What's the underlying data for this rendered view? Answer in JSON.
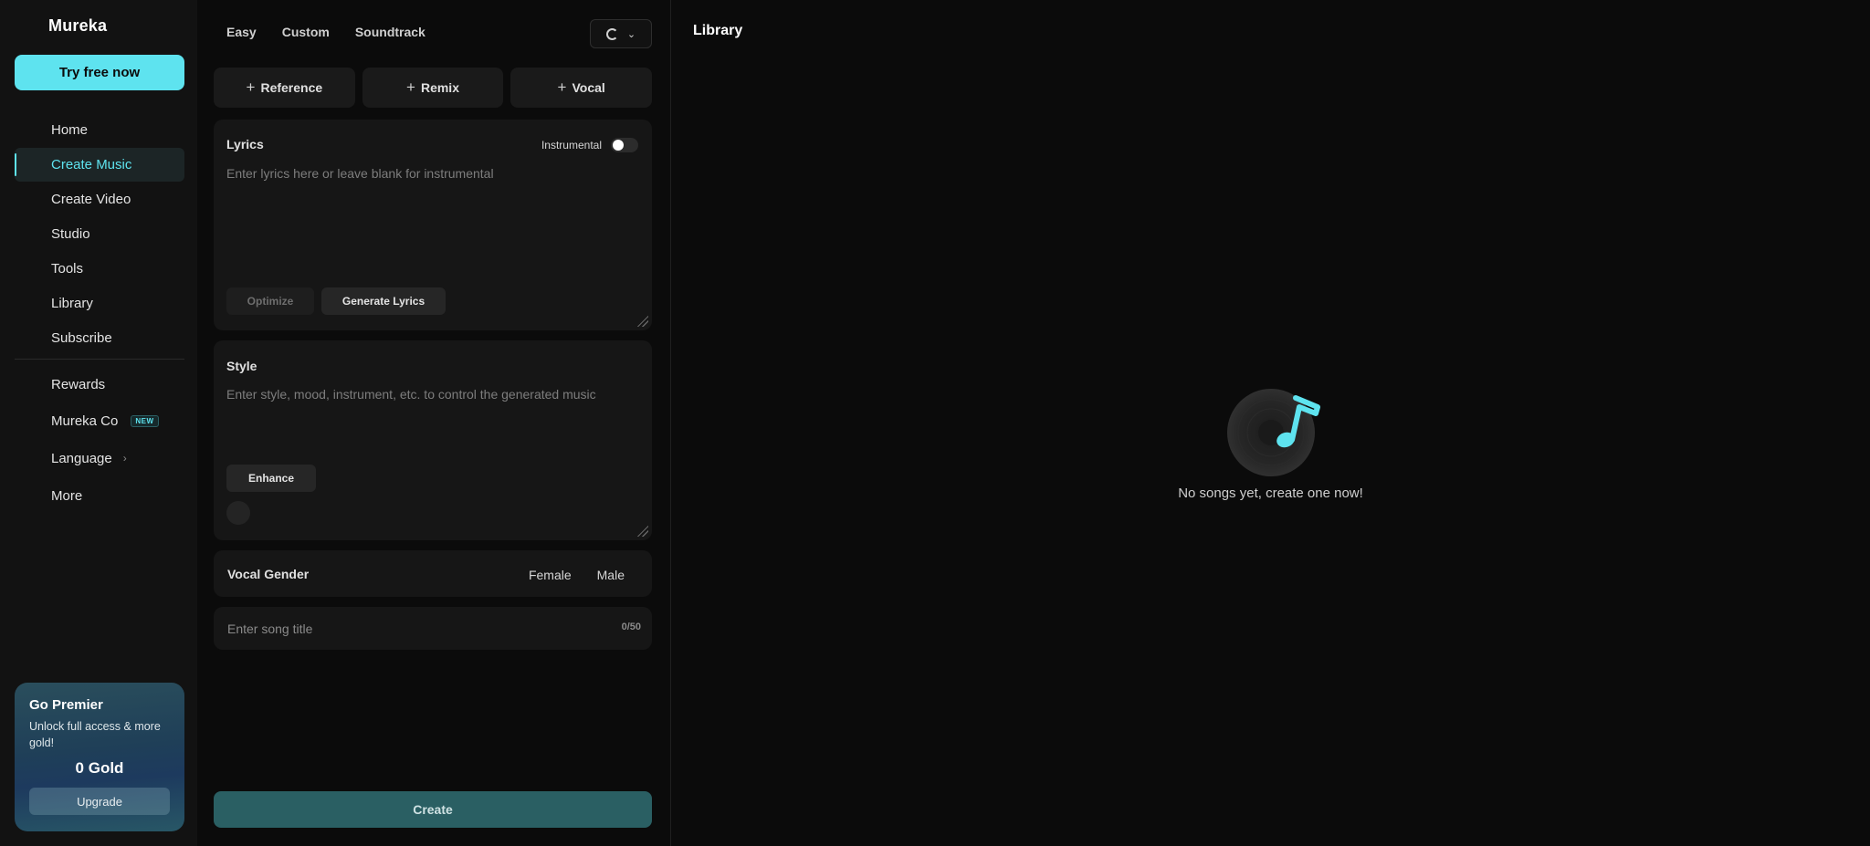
{
  "sidebar": {
    "logo": "Mureka",
    "try_button": "Try free now",
    "nav": {
      "home": "Home",
      "create_music": "Create Music",
      "create_video": "Create Video",
      "studio": "Studio",
      "tools": "Tools",
      "library": "Library",
      "subscribe": "Subscribe",
      "rewards": "Rewards",
      "mureka_co": "Mureka Co",
      "mureka_co_badge": "NEW",
      "language": "Language",
      "more": "More"
    },
    "premier": {
      "title": "Go Premier",
      "description": "Unlock full access & more gold!",
      "gold": "0 Gold",
      "upgrade_button": "Upgrade"
    }
  },
  "create": {
    "modes": [
      "Easy",
      "Custom",
      "Soundtrack"
    ],
    "add_buttons": {
      "reference": "Reference",
      "remix": "Remix",
      "vocal": "Vocal"
    },
    "lyrics": {
      "title": "Lyrics",
      "instrumental_label": "Instrumental",
      "placeholder": "Enter lyrics here or leave blank for instrumental",
      "optimize": "Optimize",
      "generate": "Generate Lyrics"
    },
    "style": {
      "title": "Style",
      "placeholder": "Enter style, mood, instrument, etc. to control the generated music",
      "enhance": "Enhance"
    },
    "vocal_gender": {
      "title": "Vocal Gender",
      "female": "Female",
      "male": "Male"
    },
    "song_title": {
      "placeholder": "Enter song title",
      "counter": "0/50"
    },
    "create_button": "Create"
  },
  "library": {
    "title": "Library",
    "empty_message": "No songs yet, create one now!"
  },
  "colors": {
    "accent": "#5ee3ef",
    "create_button": "#2a5f63"
  }
}
